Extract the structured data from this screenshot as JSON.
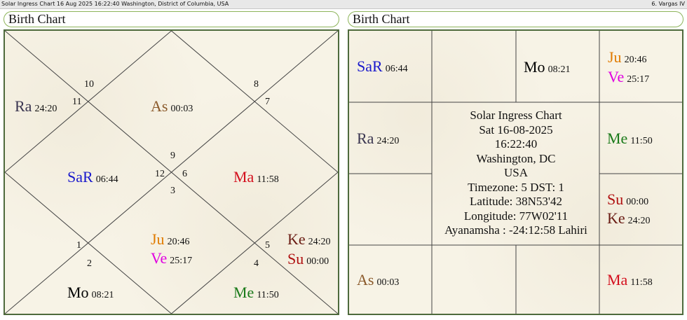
{
  "topbar": {
    "left_text": "Solar Ingress Chart 16 Aug 2025 16:22:40  Washington, District of Columbia, USA",
    "right_text": "6. Vargas IV"
  },
  "north_chart": {
    "title": "Birth Chart",
    "house_numbers": [
      "1",
      "2",
      "3",
      "4",
      "5",
      "6",
      "7",
      "8",
      "9",
      "10",
      "11",
      "12"
    ],
    "planets": [
      {
        "abbr": "Ra",
        "deg": "24:20",
        "color": "#3a3550"
      },
      {
        "abbr": "As",
        "deg": "00:03",
        "color": "#8b5a2b"
      },
      {
        "abbr": "SaR",
        "deg": "06:44",
        "color": "#1a1acc"
      },
      {
        "abbr": "Ma",
        "deg": "11:58",
        "color": "#d4101e"
      },
      {
        "abbr": "Ju",
        "deg": "20:46",
        "color": "#e07b00"
      },
      {
        "abbr": "Ve",
        "deg": "25:17",
        "color": "#e000e0"
      },
      {
        "abbr": "Ke",
        "deg": "24:20",
        "color": "#6a1c14"
      },
      {
        "abbr": "Su",
        "deg": "00:00",
        "color": "#b01010"
      },
      {
        "abbr": "Mo",
        "deg": "08:21",
        "color": "#000000"
      },
      {
        "abbr": "Me",
        "deg": "11:50",
        "color": "#1a7a1a"
      }
    ]
  },
  "south_chart": {
    "title": "Birth Chart",
    "planets": [
      {
        "abbr": "SaR",
        "deg": "06:44",
        "color": "#1a1acc"
      },
      {
        "abbr": "Mo",
        "deg": "08:21",
        "color": "#000000"
      },
      {
        "abbr": "Ju",
        "deg": "20:46",
        "color": "#e07b00"
      },
      {
        "abbr": "Ve",
        "deg": "25:17",
        "color": "#e000e0"
      },
      {
        "abbr": "Ra",
        "deg": "24:20",
        "color": "#3a3550"
      },
      {
        "abbr": "Me",
        "deg": "11:50",
        "color": "#1a7a1a"
      },
      {
        "abbr": "Su",
        "deg": "00:00",
        "color": "#b01010"
      },
      {
        "abbr": "Ke",
        "deg": "24:20",
        "color": "#6a1c14"
      },
      {
        "abbr": "As",
        "deg": "00:03",
        "color": "#8b5a2b"
      },
      {
        "abbr": "Ma",
        "deg": "11:58",
        "color": "#d4101e"
      }
    ],
    "info_lines": [
      "Solar Ingress Chart",
      "Sat 16-08-2025",
      "16:22:40",
      "Washington, DC",
      "USA",
      "Timezone: 5 DST: 1",
      "Latitude: 38N53'42",
      "Longitude: 77W02'11",
      "Ayanamsha : -24:12:58 Lahiri"
    ]
  }
}
